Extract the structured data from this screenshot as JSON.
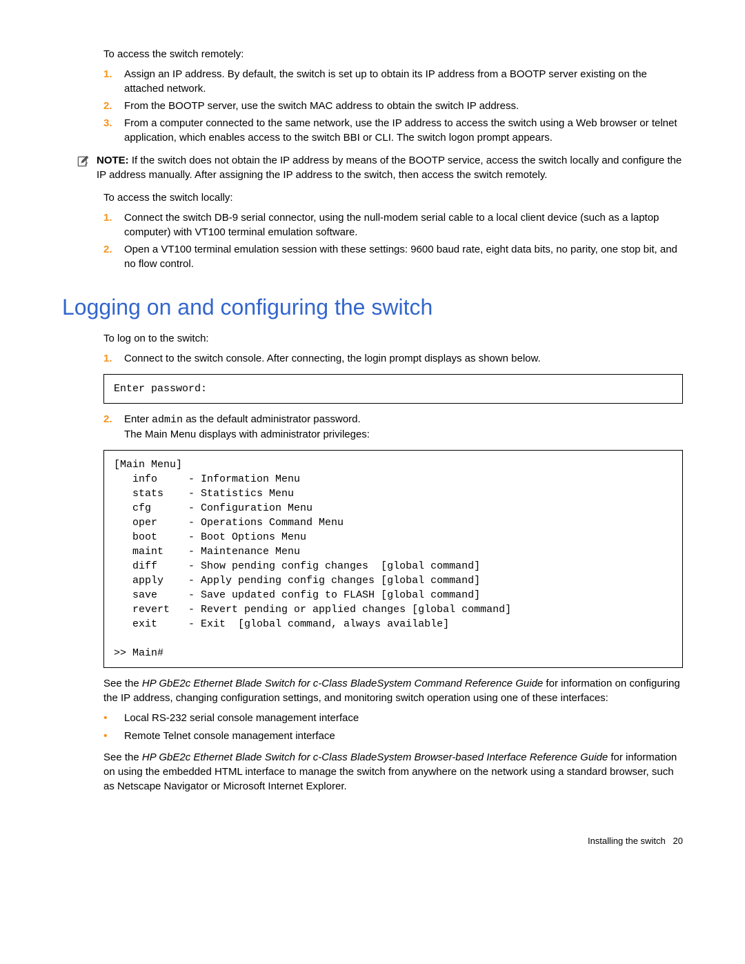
{
  "intro_remote": "To access the switch remotely:",
  "remote_steps": [
    "Assign an IP address. By default, the switch is set up to obtain its IP address from a BOOTP server existing on the attached network.",
    "From the BOOTP server, use the switch MAC address to obtain the switch IP address.",
    "From a computer connected to the same network, use the IP address to access the switch using a Web browser or telnet application, which enables access to the switch BBI or CLI. The switch logon prompt appears."
  ],
  "note_label": "NOTE:",
  "note_body": " If the switch does not obtain the IP address by means of the BOOTP service, access the switch locally and configure the IP address manually. After assigning the IP address to the switch, then access the switch remotely.",
  "intro_local": "To access the switch locally:",
  "local_steps": [
    "Connect the switch DB-9 serial connector, using the null-modem serial cable to a local client device (such as a laptop computer) with VT100 terminal emulation software.",
    "Open a VT100 terminal emulation session with these settings: 9600 baud rate, eight data bits, no parity, one stop bit, and no flow control."
  ],
  "heading": "Logging on and configuring the switch",
  "intro_logon": "To log on to the switch:",
  "logon_step1": "Connect to the switch console. After connecting, the login prompt displays as shown below.",
  "codebox1": "Enter password:",
  "logon_step2_prefix": "Enter ",
  "logon_step2_code": "admin",
  "logon_step2_suffix": " as the default administrator password.",
  "logon_step2_line2": "The Main Menu displays with administrator privileges:",
  "codebox2": "[Main Menu]\n   info     - Information Menu\n   stats    - Statistics Menu\n   cfg      - Configuration Menu\n   oper     - Operations Command Menu\n   boot     - Boot Options Menu\n   maint    - Maintenance Menu\n   diff     - Show pending config changes  [global command]\n   apply    - Apply pending config changes [global command]\n   save     - Save updated config to FLASH [global command]\n   revert   - Revert pending or applied changes [global command]\n   exit     - Exit  [global command, always available]\n\n>> Main#",
  "ref1_prefix": "See the ",
  "ref1_italic": "HP GbE2c Ethernet Blade Switch for c-Class BladeSystem Command Reference Guide",
  "ref1_suffix": " for information on configuring the IP address, changing configuration settings, and monitoring switch operation using one of these interfaces:",
  "interfaces": [
    "Local RS-232 serial console management interface",
    "Remote Telnet console management interface"
  ],
  "ref2_prefix": "See the ",
  "ref2_italic": "HP GbE2c Ethernet Blade Switch for c-Class BladeSystem Browser-based Interface Reference Guide",
  "ref2_suffix": " for information on using the embedded HTML interface to manage the switch from anywhere on the network using a standard browser, such as Netscape Navigator or Microsoft Internet Explorer.",
  "footer_label": "Installing the switch",
  "footer_page": "20"
}
